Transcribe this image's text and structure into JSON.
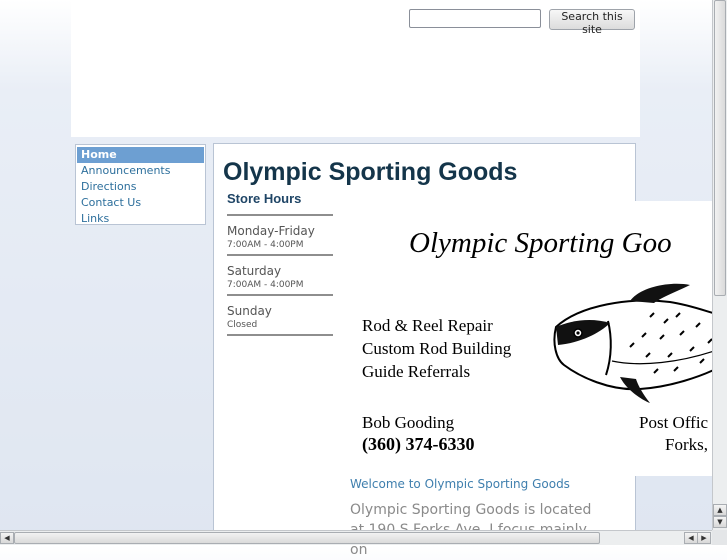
{
  "search": {
    "placeholder": "",
    "button_label": "Search this site"
  },
  "nav": {
    "items": [
      {
        "label": "Home",
        "active": true
      },
      {
        "label": "Announcements"
      },
      {
        "label": "Directions"
      },
      {
        "label": "Contact Us"
      },
      {
        "label": "Links"
      }
    ]
  },
  "main": {
    "title": "Olympic Sporting Goods",
    "hours_title": "Store Hours",
    "hours": [
      {
        "day": "Monday-Friday",
        "time": "7:00AM - 4:00PM"
      },
      {
        "day": "Saturday",
        "time": "7:00AM - 4:00PM"
      },
      {
        "day": "Sunday",
        "time": "Closed"
      }
    ],
    "banner": {
      "title": "Olympic Sporting Goo",
      "services": [
        "Rod & Reel Repair",
        "Custom Rod Building",
        "Guide Referrals"
      ],
      "name": "Bob Gooding",
      "phone": "(360) 374-6330",
      "po": "Post Offic",
      "city": "Forks,",
      "fish_icon": "trout-illustration-icon"
    },
    "welcome": "Welcome to Olympic Sporting Goods",
    "intro": "Olympic Sporting Goods is located at 190 S Forks Ave. I focus mainly on"
  },
  "colors": {
    "title": "#14354a",
    "link": "#2d6f9c",
    "nav_active": "#6d9fd2"
  }
}
